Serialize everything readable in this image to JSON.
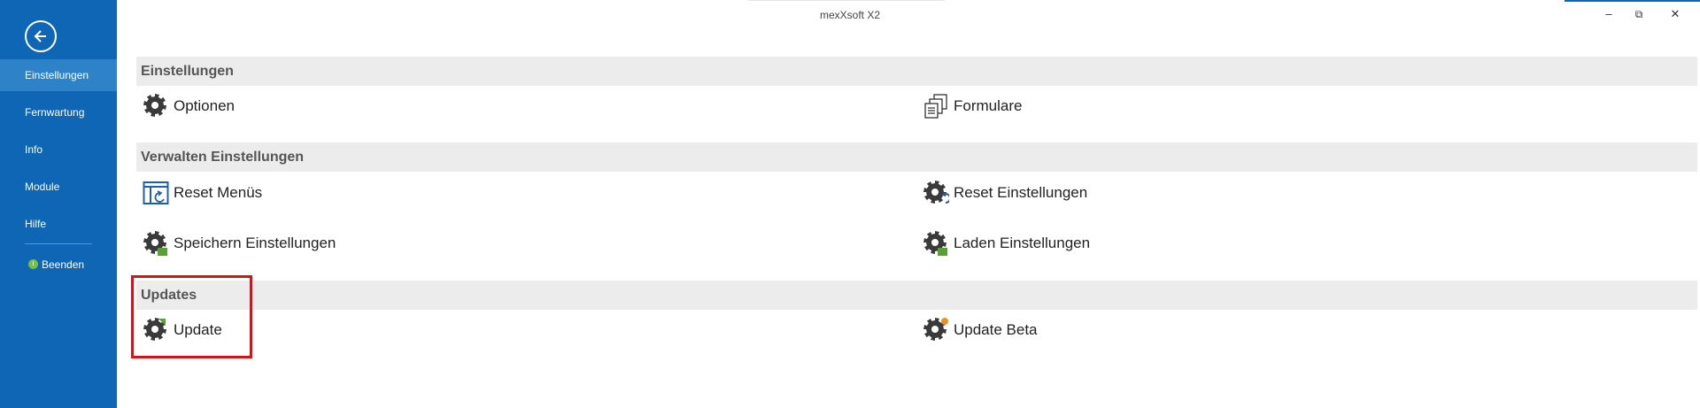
{
  "window": {
    "title": "mexXsoft X2",
    "controls": {
      "minimize": "–",
      "restore": "⧉",
      "close": "✕"
    }
  },
  "sidebar": {
    "back_icon": "arrow-left-icon",
    "items": [
      {
        "label": "Einstellungen",
        "active": true
      },
      {
        "label": "Fernwartung"
      },
      {
        "label": "Info"
      },
      {
        "label": "Module"
      },
      {
        "label": "Hilfe"
      }
    ],
    "quit": {
      "label": "Beenden",
      "icon": "power-icon",
      "color": "#76c043"
    },
    "bg": "#0f66b4",
    "active_bg": "#2d82c8"
  },
  "sections": [
    {
      "title": "Einstellungen",
      "commands": [
        {
          "label": "Optionen",
          "icon": "gear-icon"
        },
        {
          "label": "Formulare",
          "icon": "forms-icon"
        }
      ]
    },
    {
      "title": "Verwalten Einstellungen",
      "commands": [
        {
          "label": "Reset Menüs",
          "icon": "reset-menu-icon"
        },
        {
          "label": "Reset Einstellungen",
          "icon": "gear-reset-icon"
        },
        {
          "label": "Speichern Einstellungen",
          "icon": "gear-save-icon"
        },
        {
          "label": "Laden Einstellungen",
          "icon": "gear-load-icon"
        }
      ]
    },
    {
      "title": "Updates",
      "commands": [
        {
          "label": "Update",
          "icon": "gear-update-icon"
        },
        {
          "label": "Update Beta",
          "icon": "gear-beta-icon"
        }
      ]
    }
  ],
  "highlight_color": "#d0141a"
}
